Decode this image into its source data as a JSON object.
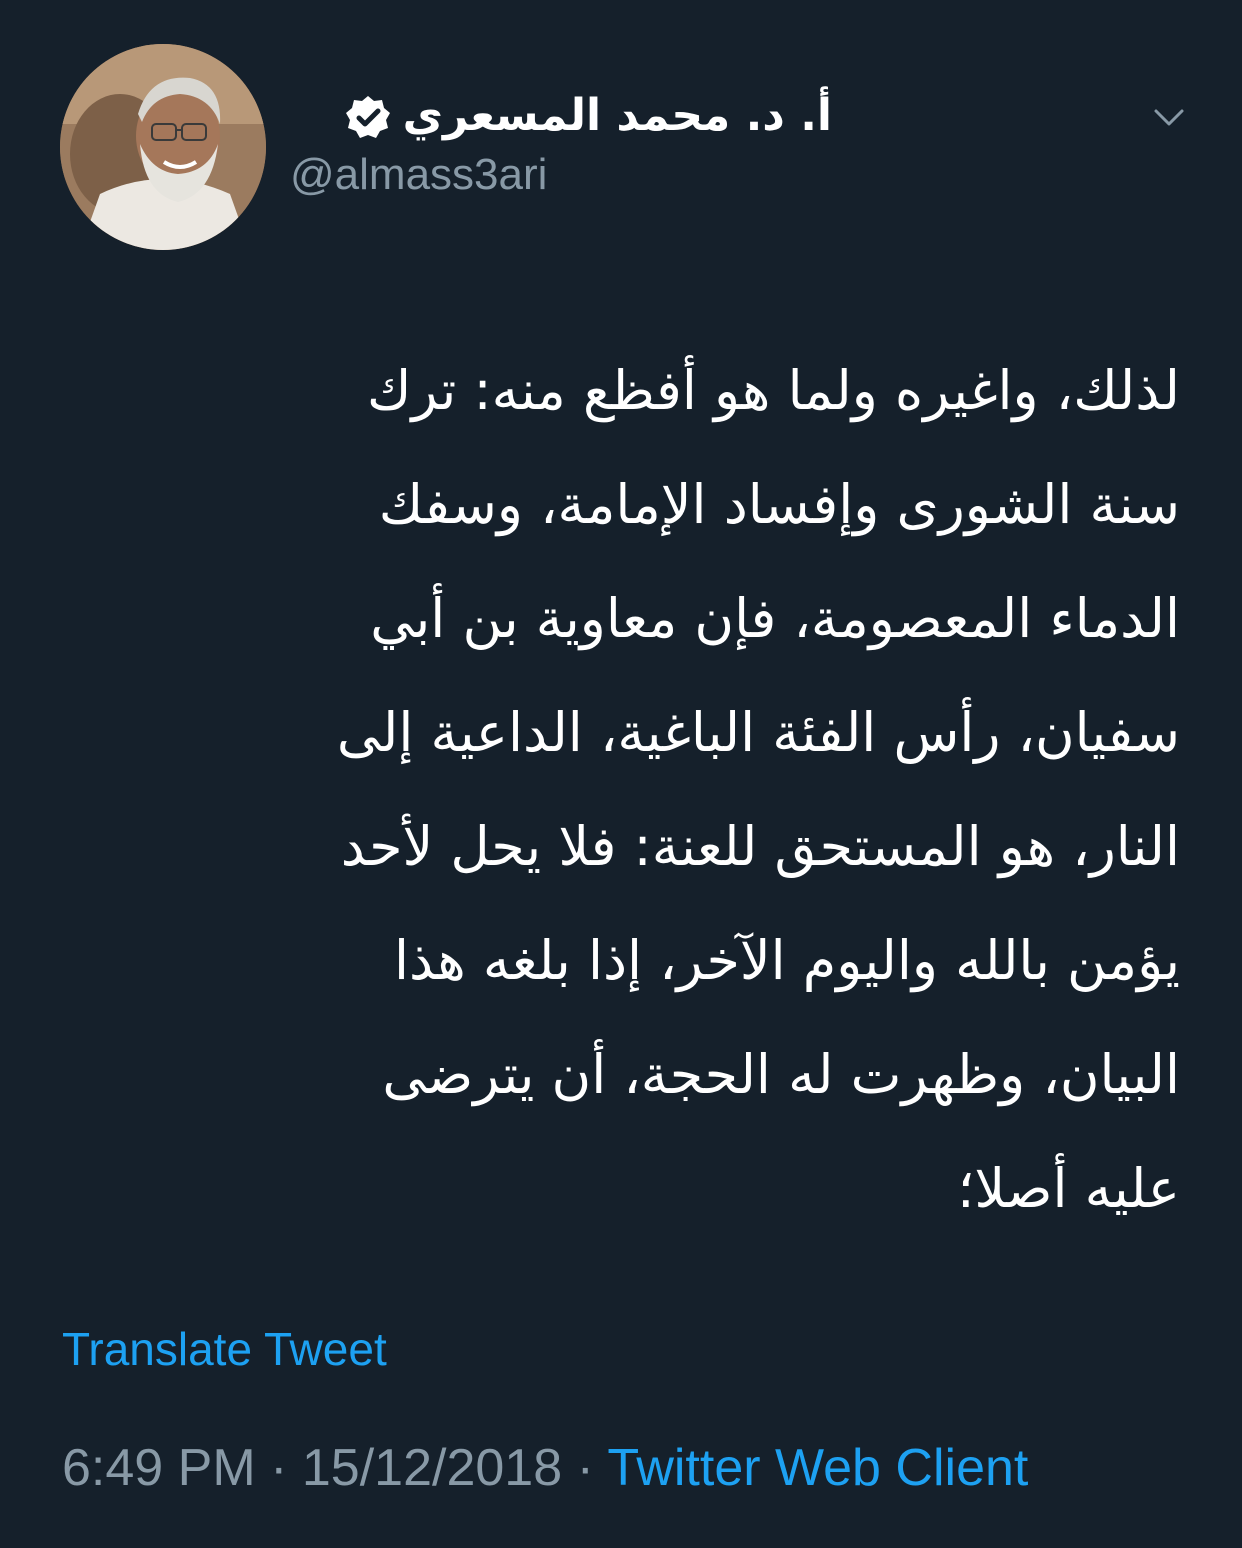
{
  "profile": {
    "display_name": "أ. د. محمد المسعري",
    "handle": "@almass3ari",
    "verified_icon": "verified-badge-icon",
    "avatar_icon": "profile-photo"
  },
  "header": {
    "menu_icon": "chevron-down-icon"
  },
  "tweet": {
    "lines": [
      "لذلك، واغيره ولما هو أفظع منه: ترك",
      "سنة الشورى وإفساد الإمامة، وسفك",
      "الدماء المعصومة، فإن معاوية بن أبي",
      "سفيان، رأس الفئة الباغية، الداعية إلى",
      "النار، هو المستحق للعنة: فلا يحل لأحد",
      "يؤمن بالله واليوم الآخر، إذا بلغه هذا",
      "البيان، وظهرت له الحجة، أن يترضى",
      "عليه أصلا؛"
    ],
    "translate_label": "Translate Tweet"
  },
  "meta": {
    "time": "6:49 PM",
    "separator": " · ",
    "date": "15/12/2018",
    "source": "Twitter Web Client"
  },
  "colors": {
    "background": "#15202b",
    "text": "#ffffff",
    "muted": "#8899a6",
    "accent": "#1da1f2"
  }
}
